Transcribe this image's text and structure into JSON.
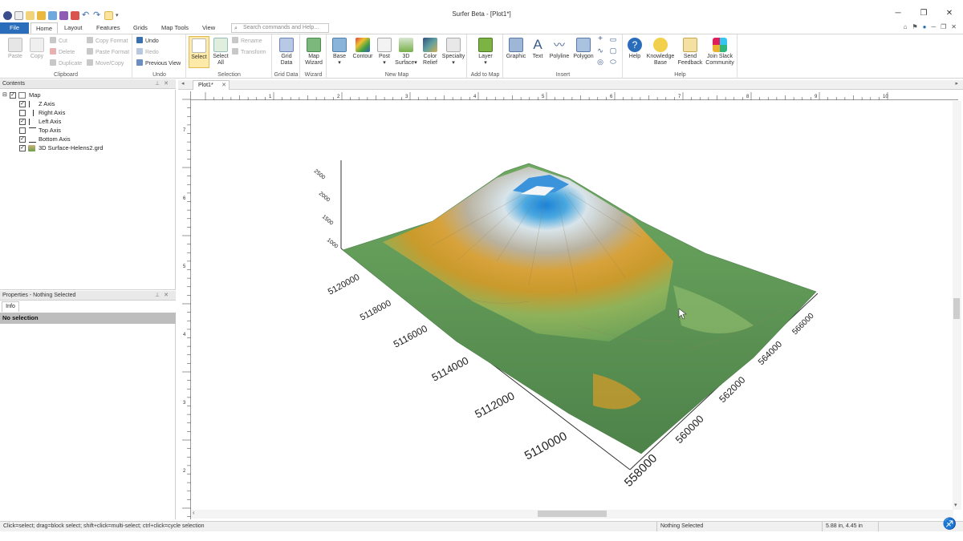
{
  "app": {
    "title": "Surfer Beta - [Plot1*]",
    "tabs": [
      "File",
      "Home",
      "Layout",
      "Features",
      "Grids",
      "Map Tools",
      "View"
    ],
    "active_tab": "Home",
    "search_placeholder": "Search commands and Help..."
  },
  "ribbon": {
    "clipboard": {
      "label": "Clipboard",
      "paste": "Paste",
      "copy": "Copy",
      "cut": "Cut",
      "delete": "Delete",
      "duplicate": "Duplicate",
      "copy_format": "Copy Format",
      "paste_format": "Paste Format",
      "move_copy": "Move/Copy"
    },
    "undo": {
      "label": "Undo",
      "undo": "Undo",
      "redo": "Redo",
      "previous_view": "Previous View"
    },
    "selection": {
      "label": "Selection",
      "select": "Select",
      "select_all_1": "Select",
      "select_all_2": "All",
      "rename": "Rename",
      "transform": "Transform"
    },
    "grid_data": {
      "label": "Grid Data",
      "line1": "Grid",
      "line2": "Data"
    },
    "wizard": {
      "label": "Wizard",
      "line1": "Map",
      "line2": "Wizard"
    },
    "new_map": {
      "label": "New Map",
      "base": "Base",
      "contour": "Contour",
      "post": "Post",
      "surface_1": "3D",
      "surface_2": "Surface",
      "relief_1": "Color",
      "relief_2": "Relief",
      "specialty": "Specialty"
    },
    "add_to_map": {
      "label": "Add to Map",
      "layer": "Layer"
    },
    "insert": {
      "label": "Insert",
      "graphic": "Graphic",
      "text": "Text",
      "polyline": "Polyline",
      "polygon": "Polygon"
    },
    "help": {
      "label": "Help",
      "help": "Help",
      "kb_1": "Knowledge",
      "kb_2": "Base",
      "feedback_1": "Send",
      "feedback_2": "Feedback",
      "slack_1": "Join Slack",
      "slack_2": "Community"
    }
  },
  "contents": {
    "title": "Contents",
    "items": [
      {
        "label": "Map",
        "checked": true
      },
      {
        "label": "Z Axis",
        "checked": true
      },
      {
        "label": "Right Axis",
        "checked": false
      },
      {
        "label": "Left Axis",
        "checked": true
      },
      {
        "label": "Top Axis",
        "checked": false
      },
      {
        "label": "Bottom Axis",
        "checked": true
      },
      {
        "label": "3D Surface-Helens2.grd",
        "checked": true
      }
    ]
  },
  "properties": {
    "title": "Properties - Nothing Selected",
    "tab": "Info",
    "selection": "No selection"
  },
  "document": {
    "tab": "Plot1*",
    "ruler_h": [
      "1",
      "2",
      "3",
      "4",
      "5",
      "6",
      "7",
      "8",
      "9",
      "10"
    ],
    "ruler_v": [
      "7",
      "6",
      "5",
      "4",
      "3",
      "2",
      "1"
    ],
    "z_ticks": [
      "2500",
      "2000",
      "1500",
      "1000"
    ],
    "left_ticks": [
      "5120000",
      "5118000",
      "5116000",
      "5114000",
      "5112000",
      "5110000"
    ],
    "bottom_ticks": [
      "558000",
      "560000",
      "562000",
      "564000",
      "566000"
    ]
  },
  "status": {
    "hint": "Click=select; drag=block select; shift+click=multi-select; ctrl+click=cycle selection",
    "selection": "Nothing Selected",
    "coords": "5.88 in, 4.45 in"
  }
}
